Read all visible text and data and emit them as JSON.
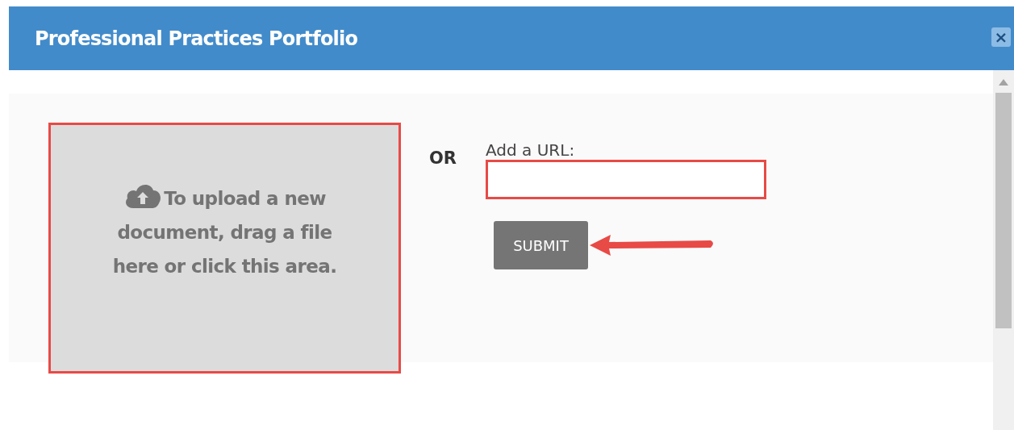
{
  "dialog": {
    "title": "Professional Practices Portfolio",
    "close": "×"
  },
  "upload_area": {
    "text": "To upload a new document, drag a file here or click this area."
  },
  "separator": "OR",
  "url_field": {
    "label": "Add a URL:"
  },
  "submit_button": "SUBMIT"
}
